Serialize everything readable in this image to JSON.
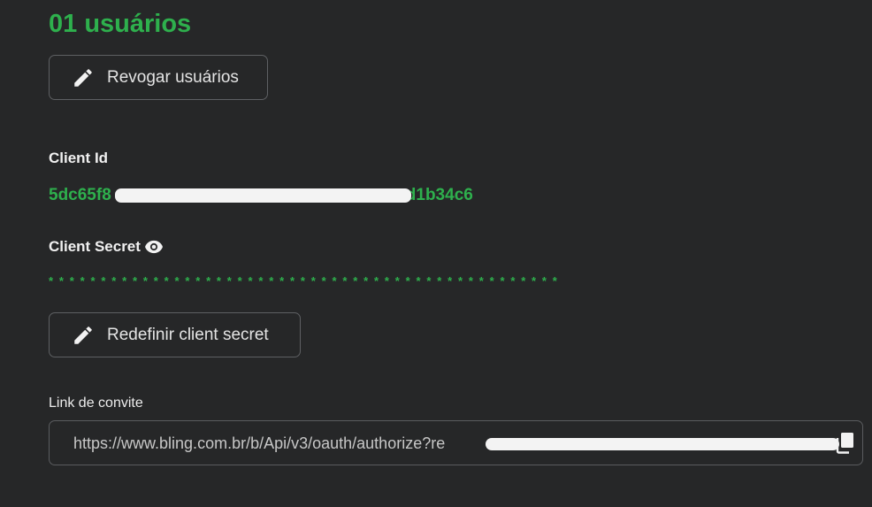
{
  "users": {
    "title": "01 usuários",
    "revoke_button_label": "Revogar usuários"
  },
  "client_id": {
    "label": "Client Id",
    "value_start": "5dc65f8",
    "value_end": "d1b34c6"
  },
  "client_secret": {
    "label": "Client Secret",
    "masked_value": "* * * * * * * * * * * * * * * * * * * * * * * * * * * * * * * * * * * * * * * * * * * * * * * * *",
    "reset_button_label": "Redefinir client secret"
  },
  "invite_link": {
    "label": "Link de convite",
    "value": "https://www.bling.com.br/b/Api/v3/oauth/authorize?re"
  },
  "icons": {
    "edit": "pencil-icon",
    "show_secret": "eye-icon",
    "copy": "copy-icon"
  },
  "colors": {
    "background": "#262728",
    "accent_green": "#2eb04d",
    "text": "#e4e4e4",
    "border": "#5e6063"
  }
}
